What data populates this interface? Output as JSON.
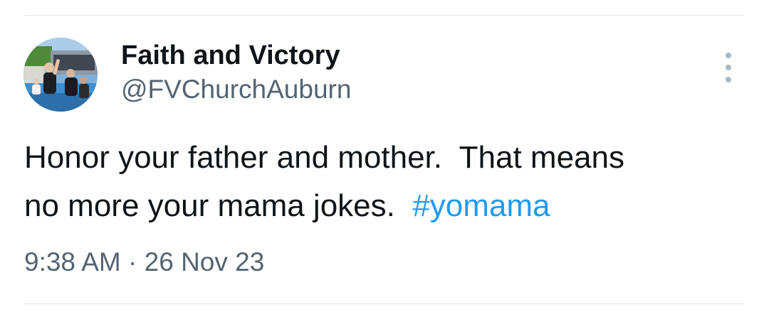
{
  "tweet": {
    "author": {
      "display_name": "Faith and Victory",
      "handle": "@FVChurchAuburn",
      "avatar_icon": "profile-photo"
    },
    "more_icon": "more-vertical-icon",
    "text_line1": "Honor your father and mother.  That means",
    "text_line2": "no more your mama jokes.  ",
    "hashtag": "#yomama",
    "time": "9:38 AM",
    "separator": " · ",
    "date": "26 Nov 23"
  },
  "colors": {
    "text": "#0f1419",
    "secondary": "#536471",
    "link": "#1d9bf0",
    "divider": "#e1e6ea"
  }
}
